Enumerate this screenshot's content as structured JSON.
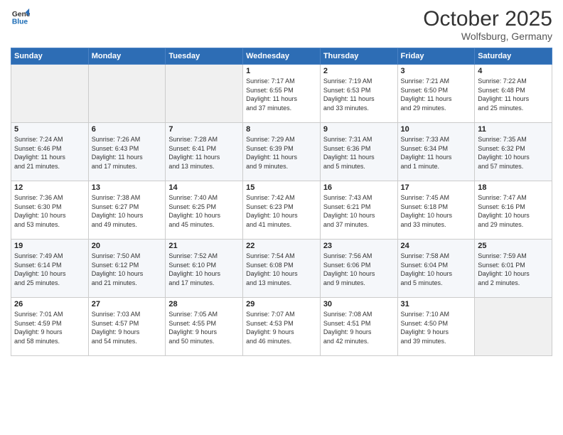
{
  "logo": {
    "line1": "General",
    "line2": "Blue"
  },
  "title": "October 2025",
  "subtitle": "Wolfsburg, Germany",
  "days_header": [
    "Sunday",
    "Monday",
    "Tuesday",
    "Wednesday",
    "Thursday",
    "Friday",
    "Saturday"
  ],
  "weeks": [
    [
      {
        "num": "",
        "info": ""
      },
      {
        "num": "",
        "info": ""
      },
      {
        "num": "",
        "info": ""
      },
      {
        "num": "1",
        "info": "Sunrise: 7:17 AM\nSunset: 6:55 PM\nDaylight: 11 hours\nand 37 minutes."
      },
      {
        "num": "2",
        "info": "Sunrise: 7:19 AM\nSunset: 6:53 PM\nDaylight: 11 hours\nand 33 minutes."
      },
      {
        "num": "3",
        "info": "Sunrise: 7:21 AM\nSunset: 6:50 PM\nDaylight: 11 hours\nand 29 minutes."
      },
      {
        "num": "4",
        "info": "Sunrise: 7:22 AM\nSunset: 6:48 PM\nDaylight: 11 hours\nand 25 minutes."
      }
    ],
    [
      {
        "num": "5",
        "info": "Sunrise: 7:24 AM\nSunset: 6:46 PM\nDaylight: 11 hours\nand 21 minutes."
      },
      {
        "num": "6",
        "info": "Sunrise: 7:26 AM\nSunset: 6:43 PM\nDaylight: 11 hours\nand 17 minutes."
      },
      {
        "num": "7",
        "info": "Sunrise: 7:28 AM\nSunset: 6:41 PM\nDaylight: 11 hours\nand 13 minutes."
      },
      {
        "num": "8",
        "info": "Sunrise: 7:29 AM\nSunset: 6:39 PM\nDaylight: 11 hours\nand 9 minutes."
      },
      {
        "num": "9",
        "info": "Sunrise: 7:31 AM\nSunset: 6:36 PM\nDaylight: 11 hours\nand 5 minutes."
      },
      {
        "num": "10",
        "info": "Sunrise: 7:33 AM\nSunset: 6:34 PM\nDaylight: 11 hours\nand 1 minute."
      },
      {
        "num": "11",
        "info": "Sunrise: 7:35 AM\nSunset: 6:32 PM\nDaylight: 10 hours\nand 57 minutes."
      }
    ],
    [
      {
        "num": "12",
        "info": "Sunrise: 7:36 AM\nSunset: 6:30 PM\nDaylight: 10 hours\nand 53 minutes."
      },
      {
        "num": "13",
        "info": "Sunrise: 7:38 AM\nSunset: 6:27 PM\nDaylight: 10 hours\nand 49 minutes."
      },
      {
        "num": "14",
        "info": "Sunrise: 7:40 AM\nSunset: 6:25 PM\nDaylight: 10 hours\nand 45 minutes."
      },
      {
        "num": "15",
        "info": "Sunrise: 7:42 AM\nSunset: 6:23 PM\nDaylight: 10 hours\nand 41 minutes."
      },
      {
        "num": "16",
        "info": "Sunrise: 7:43 AM\nSunset: 6:21 PM\nDaylight: 10 hours\nand 37 minutes."
      },
      {
        "num": "17",
        "info": "Sunrise: 7:45 AM\nSunset: 6:18 PM\nDaylight: 10 hours\nand 33 minutes."
      },
      {
        "num": "18",
        "info": "Sunrise: 7:47 AM\nSunset: 6:16 PM\nDaylight: 10 hours\nand 29 minutes."
      }
    ],
    [
      {
        "num": "19",
        "info": "Sunrise: 7:49 AM\nSunset: 6:14 PM\nDaylight: 10 hours\nand 25 minutes."
      },
      {
        "num": "20",
        "info": "Sunrise: 7:50 AM\nSunset: 6:12 PM\nDaylight: 10 hours\nand 21 minutes."
      },
      {
        "num": "21",
        "info": "Sunrise: 7:52 AM\nSunset: 6:10 PM\nDaylight: 10 hours\nand 17 minutes."
      },
      {
        "num": "22",
        "info": "Sunrise: 7:54 AM\nSunset: 6:08 PM\nDaylight: 10 hours\nand 13 minutes."
      },
      {
        "num": "23",
        "info": "Sunrise: 7:56 AM\nSunset: 6:06 PM\nDaylight: 10 hours\nand 9 minutes."
      },
      {
        "num": "24",
        "info": "Sunrise: 7:58 AM\nSunset: 6:04 PM\nDaylight: 10 hours\nand 5 minutes."
      },
      {
        "num": "25",
        "info": "Sunrise: 7:59 AM\nSunset: 6:01 PM\nDaylight: 10 hours\nand 2 minutes."
      }
    ],
    [
      {
        "num": "26",
        "info": "Sunrise: 7:01 AM\nSunset: 4:59 PM\nDaylight: 9 hours\nand 58 minutes."
      },
      {
        "num": "27",
        "info": "Sunrise: 7:03 AM\nSunset: 4:57 PM\nDaylight: 9 hours\nand 54 minutes."
      },
      {
        "num": "28",
        "info": "Sunrise: 7:05 AM\nSunset: 4:55 PM\nDaylight: 9 hours\nand 50 minutes."
      },
      {
        "num": "29",
        "info": "Sunrise: 7:07 AM\nSunset: 4:53 PM\nDaylight: 9 hours\nand 46 minutes."
      },
      {
        "num": "30",
        "info": "Sunrise: 7:08 AM\nSunset: 4:51 PM\nDaylight: 9 hours\nand 42 minutes."
      },
      {
        "num": "31",
        "info": "Sunrise: 7:10 AM\nSunset: 4:50 PM\nDaylight: 9 hours\nand 39 minutes."
      },
      {
        "num": "",
        "info": ""
      }
    ]
  ]
}
